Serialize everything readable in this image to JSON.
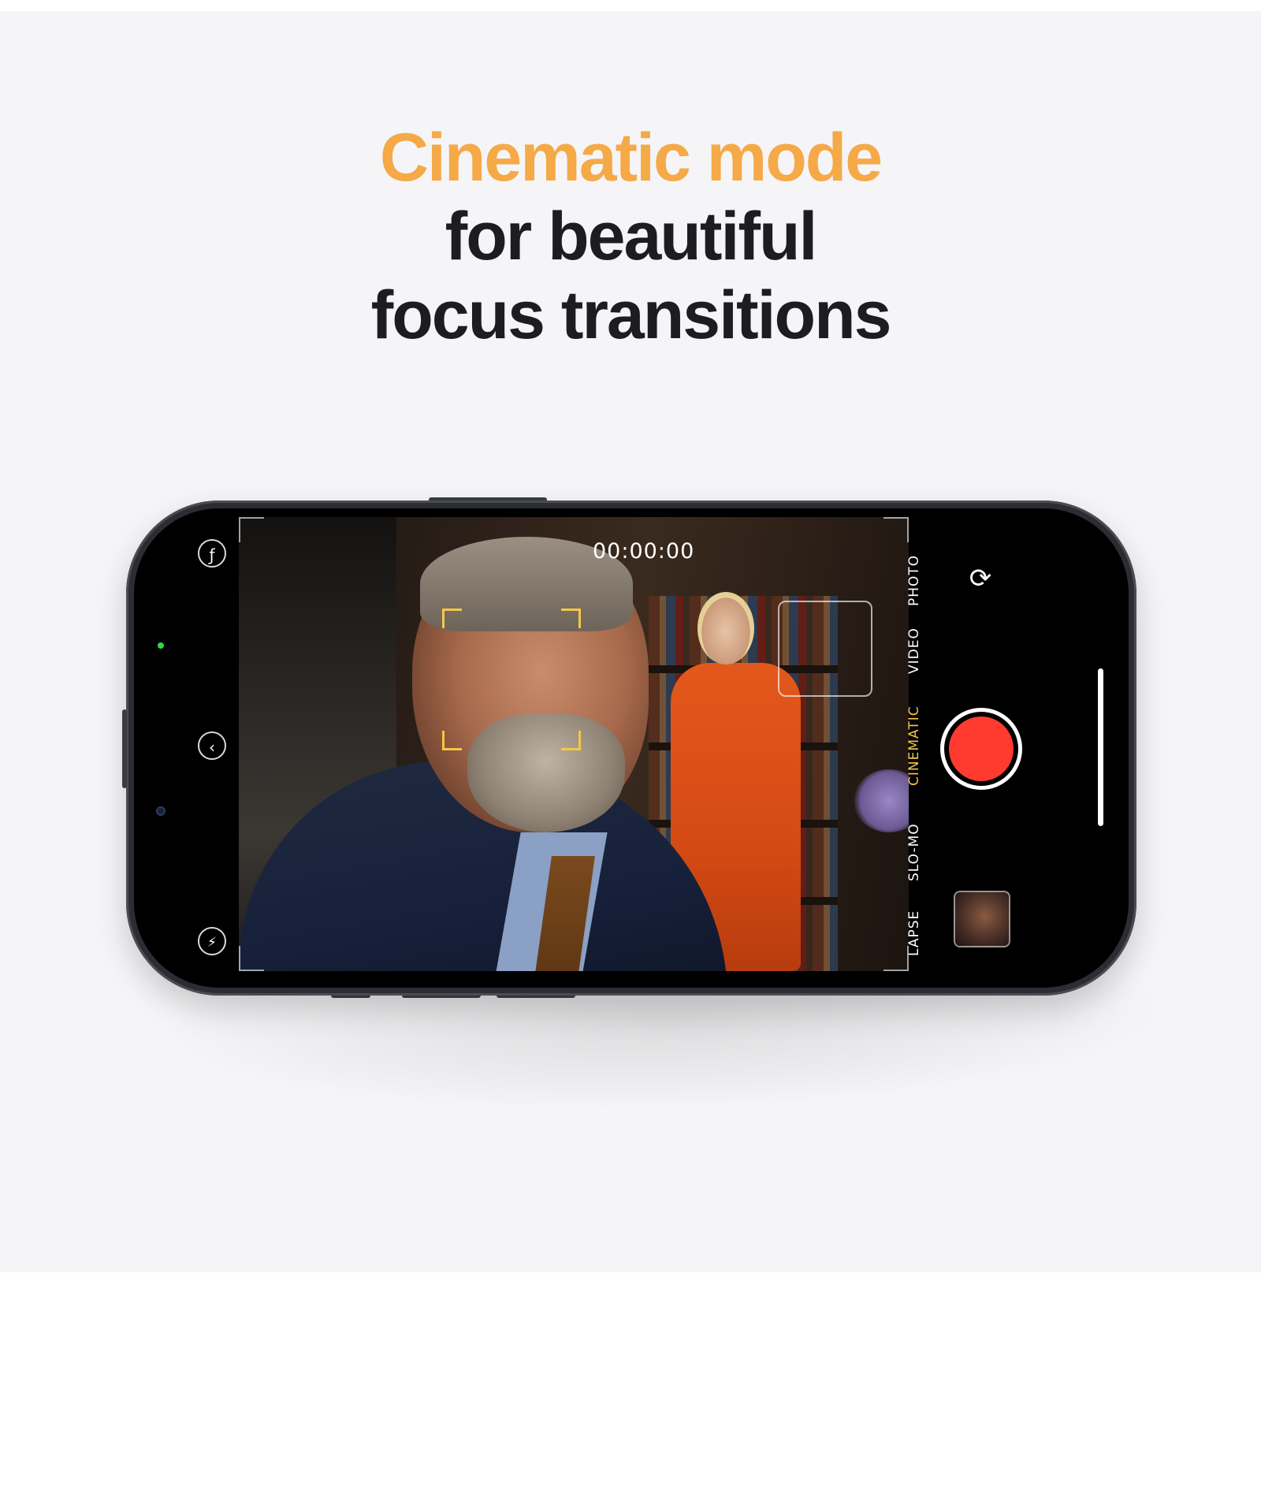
{
  "headline": {
    "line1": "Cinematic mode",
    "line2": "for beautiful",
    "line3": "focus transitions"
  },
  "colors": {
    "accent": "#f5a947",
    "text_dark": "#1d1d1f",
    "background": "#f5f5f7",
    "record_red": "#ff3b30",
    "focus_yellow": "#f6c744"
  },
  "camera": {
    "timer": "00:00:00",
    "modes": [
      {
        "label": "LAPSE",
        "active": false
      },
      {
        "label": "SLO-MO",
        "active": false
      },
      {
        "label": "CINEMATIC",
        "active": true
      },
      {
        "label": "VIDEO",
        "active": false
      },
      {
        "label": "PHOTO",
        "active": false
      }
    ],
    "icons": {
      "aperture": "ƒ",
      "chevron": "‹",
      "flash": "⚡",
      "flip": "⟳"
    }
  }
}
